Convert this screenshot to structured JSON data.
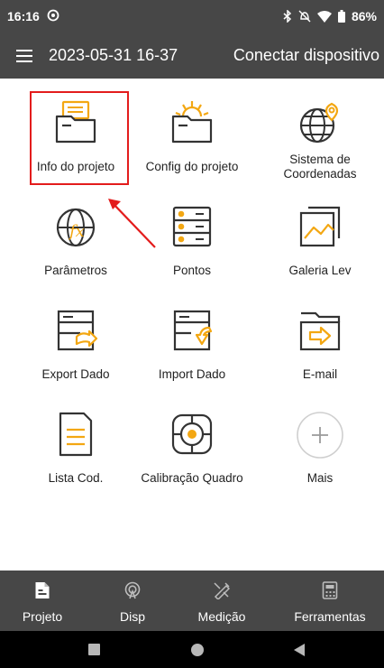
{
  "status_bar": {
    "time": "16:16",
    "battery": "86%"
  },
  "app_bar": {
    "title": "2023-05-31 16-37",
    "connect_label": "Conectar dispositivo"
  },
  "grid": {
    "items": [
      {
        "label": "Info do projeto",
        "icon": "project-info-folder-icon"
      },
      {
        "label": "Config do projeto",
        "icon": "project-config-folder-icon"
      },
      {
        "label_line1": "Sistema de",
        "label_line2": "Coordenadas",
        "icon": "coordinate-globe-pin-icon"
      },
      {
        "label": "Parâmetros",
        "icon": "parameters-globe-fx-icon"
      },
      {
        "label": "Pontos",
        "icon": "points-list-icon"
      },
      {
        "label": "Galeria Lev",
        "icon": "gallery-image-icon"
      },
      {
        "label": "Export Dado",
        "icon": "export-data-icon"
      },
      {
        "label": "Import Dado",
        "icon": "import-data-icon"
      },
      {
        "label": "E-mail",
        "icon": "email-folder-arrow-icon"
      },
      {
        "label": "Lista Cod.",
        "icon": "code-list-document-icon"
      },
      {
        "label": "Calibração Quadro",
        "icon": "calibration-target-icon"
      },
      {
        "label": "Mais",
        "icon": "plus-circle-icon"
      }
    ]
  },
  "bottom_nav": {
    "items": [
      {
        "label": "Projeto",
        "icon": "project-document-icon"
      },
      {
        "label": "Disp",
        "icon": "device-antenna-icon"
      },
      {
        "label": "Medição",
        "icon": "measure-tools-icon"
      },
      {
        "label": "Ferramentas",
        "icon": "calculator-icon"
      }
    ]
  },
  "colors": {
    "bar": "#474747",
    "accent": "#f3a712",
    "icon_stroke": "#333333",
    "highlight": "#e31c1c"
  }
}
